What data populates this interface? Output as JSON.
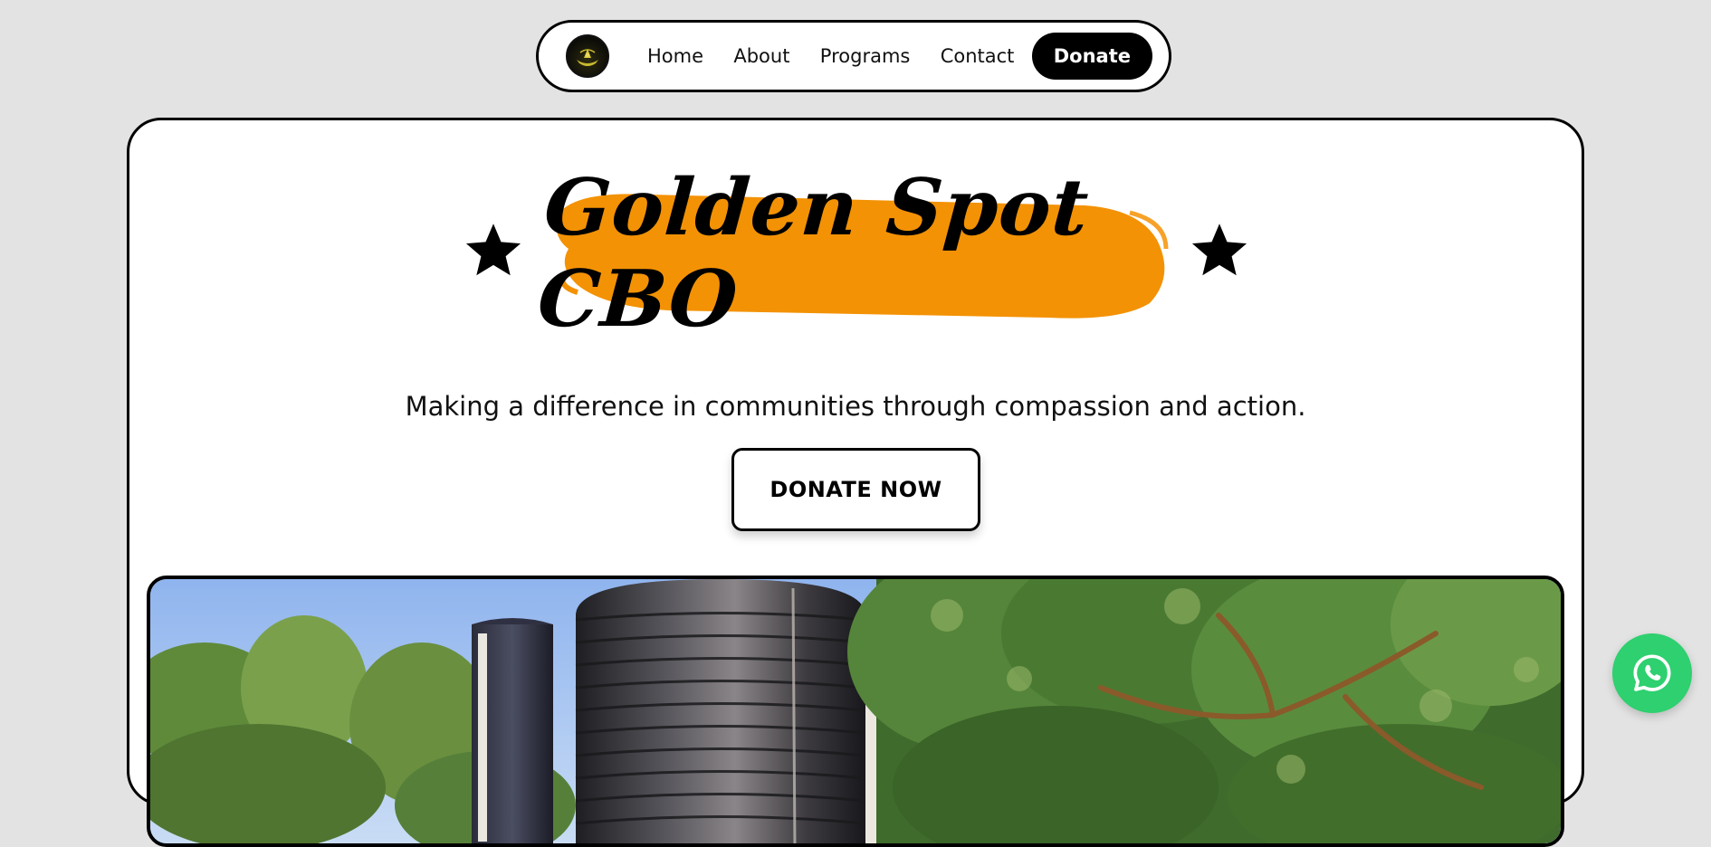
{
  "nav": {
    "logo_icon": "golden-spot-logo",
    "items": [
      {
        "label": "Home"
      },
      {
        "label": "About"
      },
      {
        "label": "Programs"
      },
      {
        "label": "Contact"
      }
    ],
    "donate_label": "Donate"
  },
  "hero": {
    "title": "Golden Spot CBO",
    "title_highlight_color": "#f39204",
    "tagline": "Making a difference in communities through compassion and action.",
    "cta_label": "DONATE NOW",
    "star_icon": "star-icon",
    "photo": "water-tanks-and-trees-photo"
  },
  "floating": {
    "whatsapp_icon": "whatsapp-icon",
    "color": "#2ed06f"
  }
}
